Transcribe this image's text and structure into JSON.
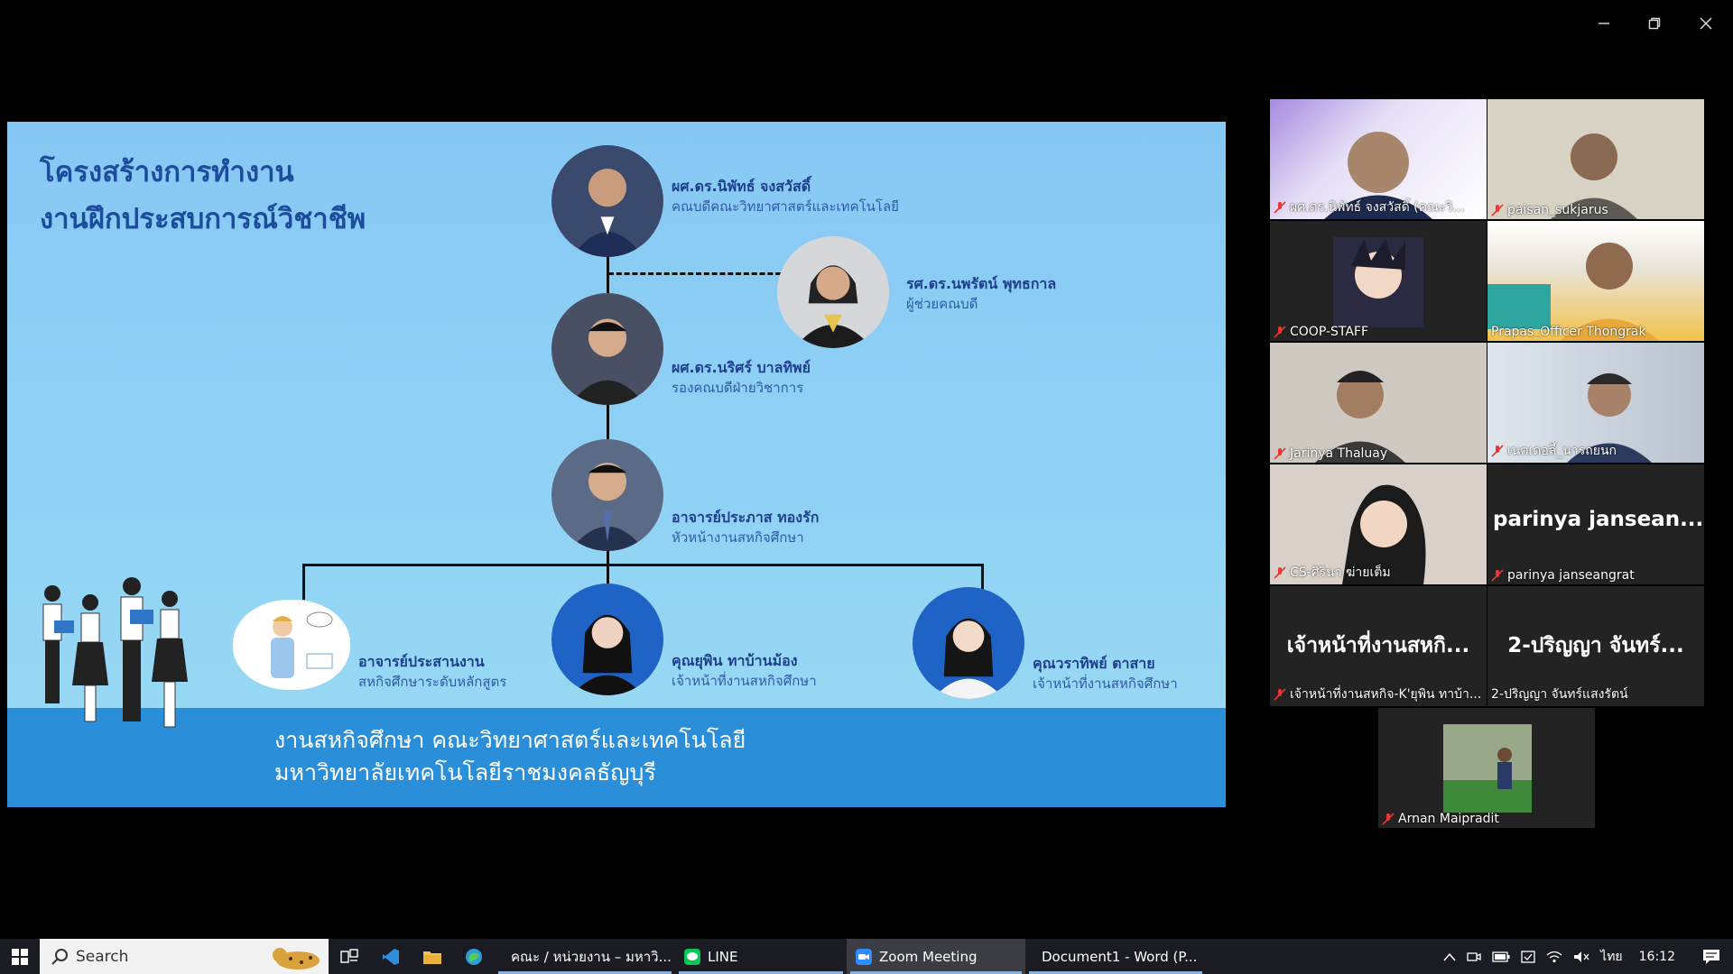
{
  "window": {
    "controls": [
      "minimize",
      "restore",
      "close"
    ]
  },
  "slide": {
    "title_line1": "โครงสร้างการทำงาน",
    "title_line2": "งานฝึกประสบการณ์วิชาชีพ",
    "footer_line1": "งานสหกิจศึกษา คณะวิทยาศาสตร์และเทคโนโลยี",
    "footer_line2": "มหาวิทยาลัยเทคโนโลยีราชมงคลธัญบุรี",
    "people": [
      {
        "name": "ผศ.ดร.นิพัทธ์ จงสวัสดิ์",
        "role": "คณบดีคณะวิทยาศาสตร์และเทคโนโลยี"
      },
      {
        "name": "รศ.ดร.นพรัตน์ พุทธกาล",
        "role": "ผู้ช่วยคณบดี"
      },
      {
        "name": "ผศ.ดร.นริศร์ บาลทิพย์",
        "role": "รองคณบดีฝ่ายวิชาการ"
      },
      {
        "name": "อาจารย์ประภาส ทองรัก",
        "role": "หัวหน้างานสหกิจศึกษา"
      },
      {
        "name": "อาจารย์ประสานงาน",
        "role": "สหกิจศึกษาระดับหลักสูตร"
      },
      {
        "name": "คุณยุพิน ทาบ้านม้อง",
        "role": "เจ้าหน้าที่งานสหกิจศึกษา"
      },
      {
        "name": "คุณวราทิพย์ ตาสาย",
        "role": "เจ้าหน้าที่งานสหกิจศึกษา"
      }
    ]
  },
  "participants": [
    {
      "label": "ผศ.ดร.นิพัทธ์ จงสวัสดิ์ (คณะวิ...",
      "type": "screen",
      "bg": "#cfc7ee"
    },
    {
      "label": "paisan_sukjarus",
      "type": "camera",
      "bg": "#d8d2c4"
    },
    {
      "label": "COOP-STAFF",
      "type": "avatar",
      "bg": "#262626"
    },
    {
      "label": "Prapas_Officer Thongrak",
      "type": "camera",
      "bg": "#e7c16a",
      "active": true
    },
    {
      "label": "Jarinya Thaluay",
      "type": "camera",
      "bg": "#cfc9c2"
    },
    {
      "label": "เนตเดอลี้_นารถยนก",
      "type": "camera",
      "bg": "#b8c3cf"
    },
    {
      "label": "CS-ศิรินา ฆ่ายเต็ม",
      "type": "camera",
      "bg": "#d9d1c9"
    },
    {
      "label": "parinya janseangrat",
      "type": "name",
      "big": "parinya jansean..."
    },
    {
      "label": "เจ้าหน้าที่งานสหกิจ-K'ยุพิน ทาบ้า...",
      "type": "name",
      "big": "เจ้าหน้าที่งานสหกิ..."
    },
    {
      "label": "2-ปริญญา จันทร์แสงรัตน์",
      "type": "name",
      "big": "2-ปริญญา จันทร์..."
    },
    {
      "label": "Arnan Maipradit",
      "type": "avatar-photo",
      "bg": "#9aa88a"
    }
  ],
  "taskbar": {
    "search_label": "Search",
    "apps": [
      {
        "label": "คณะ / หน่วยงาน – มหาวิ...",
        "icon": "chrome-icon",
        "running": true
      },
      {
        "label": "LINE",
        "icon": "line-icon",
        "running": true
      },
      {
        "label": "Zoom Meeting",
        "icon": "zoom-icon",
        "running": true,
        "focus": true
      },
      {
        "label": "Document1 - Word (P...",
        "icon": "word-icon",
        "running": true
      }
    ],
    "language": "ไทย",
    "time": "16:12"
  }
}
